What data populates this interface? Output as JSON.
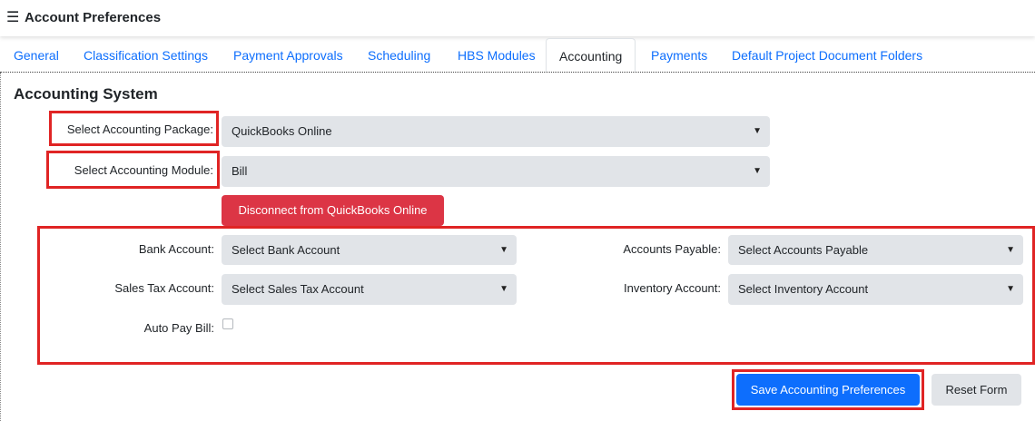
{
  "header": {
    "menu_icon": "hamburger-icon",
    "title": "Account Preferences"
  },
  "tabs": [
    {
      "label": "General"
    },
    {
      "label": "Classification Settings"
    },
    {
      "label": "Payment Approvals"
    },
    {
      "label": "Scheduling"
    },
    {
      "label": "HBS Modules"
    },
    {
      "label": "Accounting"
    },
    {
      "label": "Payments"
    },
    {
      "label": "Default Project Document Folders"
    }
  ],
  "active_tab": "Accounting",
  "section": {
    "title": "Accounting System"
  },
  "package": {
    "label": "Select Accounting Package:",
    "value": "QuickBooks Online"
  },
  "module": {
    "label": "Select Accounting Module:",
    "value": "Bill"
  },
  "disconnect_button": "Disconnect from QuickBooks Online",
  "accounts": {
    "bank": {
      "label": "Bank Account:",
      "value": "Select Bank Account"
    },
    "payable": {
      "label": "Accounts Payable:",
      "value": "Select Accounts Payable"
    },
    "sales_tax": {
      "label": "Sales Tax Account:",
      "value": "Select Sales Tax Account"
    },
    "inventory": {
      "label": "Inventory Account:",
      "value": "Select Inventory Account"
    },
    "auto_pay": {
      "label": "Auto Pay Bill:",
      "checked": false
    }
  },
  "buttons": {
    "save": "Save Accounting Preferences",
    "reset": "Reset Form"
  },
  "colors": {
    "accent": "#0d6efd",
    "danger": "#dc3545",
    "highlight": "#e02424",
    "field": "#e1e4e8"
  }
}
